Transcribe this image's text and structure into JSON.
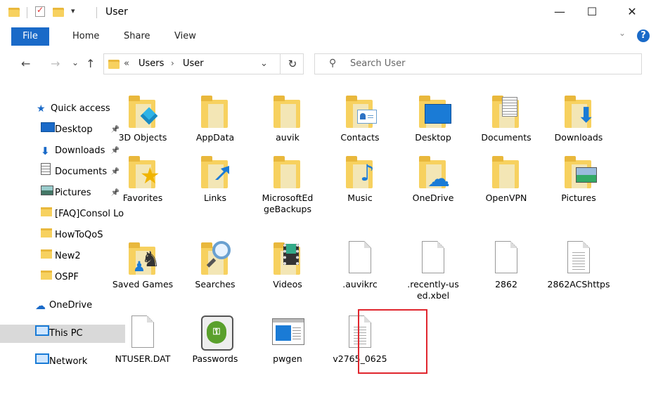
{
  "window": {
    "title": "User"
  },
  "ribbon": {
    "tabs": [
      "File",
      "Home",
      "Share",
      "View"
    ]
  },
  "nav": {
    "back": "←",
    "forward": "→",
    "recent": "⌄",
    "up": "↑",
    "breadcrumb_prefix": "«",
    "breadcrumb": [
      "Users",
      "User"
    ],
    "address_dropdown": "⌄",
    "refresh": "↻"
  },
  "search": {
    "placeholder": "Search User"
  },
  "sidebar": [
    {
      "label": "Quick access",
      "icon": "star-icon"
    },
    {
      "label": "Desktop",
      "pinned": true,
      "icon": "desktop-icon"
    },
    {
      "label": "Downloads",
      "pinned": true,
      "icon": "download-icon"
    },
    {
      "label": "Documents",
      "pinned": true,
      "icon": "document-icon"
    },
    {
      "label": "Pictures",
      "pinned": true,
      "icon": "pictures-icon"
    },
    {
      "label": "[FAQ]Consol Lo",
      "icon": "folder-icon"
    },
    {
      "label": "HowToQoS",
      "icon": "folder-icon"
    },
    {
      "label": "New2",
      "icon": "folder-icon"
    },
    {
      "label": "OSPF",
      "icon": "folder-icon"
    },
    {
      "label": "OneDrive",
      "icon": "cloud-icon"
    },
    {
      "label": "This PC",
      "icon": "pc-icon",
      "selected": true
    },
    {
      "label": "Network",
      "icon": "network-icon"
    }
  ],
  "files": [
    {
      "label": "3D Objects",
      "kind": "folder-3d"
    },
    {
      "label": "AppData",
      "kind": "folder-plain"
    },
    {
      "label": "auvik",
      "kind": "folder-plain"
    },
    {
      "label": "Contacts",
      "kind": "folder-contacts"
    },
    {
      "label": "Desktop",
      "kind": "folder-desktop"
    },
    {
      "label": "Documents",
      "kind": "folder-documents"
    },
    {
      "label": "Downloads",
      "kind": "folder-downloads"
    },
    {
      "label": "Favorites",
      "kind": "folder-favorites"
    },
    {
      "label": "Links",
      "kind": "folder-links"
    },
    {
      "label": "MicrosoftEdgeBackups",
      "kind": "folder-plain"
    },
    {
      "label": "Music",
      "kind": "folder-music"
    },
    {
      "label": "OneDrive",
      "kind": "folder-onedrive"
    },
    {
      "label": "OpenVPN",
      "kind": "folder-plain"
    },
    {
      "label": "Pictures",
      "kind": "folder-pictures"
    },
    {
      "label": "Saved Games",
      "kind": "folder-games"
    },
    {
      "label": "Searches",
      "kind": "folder-searches"
    },
    {
      "label": "Videos",
      "kind": "folder-videos"
    },
    {
      "label": ".auvikrc",
      "kind": "file-blank"
    },
    {
      "label": ".recently-used.xbel",
      "kind": "file-blank"
    },
    {
      "label": "2862",
      "kind": "file-blank"
    },
    {
      "label": "2862ACShttps",
      "kind": "file-text"
    },
    {
      "label": "NTUSER.DAT",
      "kind": "file-blank"
    },
    {
      "label": "Passwords",
      "kind": "app-keepass"
    },
    {
      "label": "pwgen",
      "kind": "app-window"
    },
    {
      "label": "v2765_0625",
      "kind": "file-text",
      "highlighted": true
    }
  ],
  "colors": {
    "accent": "#1a6ac8",
    "folder": "#f7d15f",
    "highlight_border": "#e0262e",
    "selected_bg": "#d9d9d9"
  },
  "window_controls": [
    "—",
    "☐",
    "✕"
  ]
}
